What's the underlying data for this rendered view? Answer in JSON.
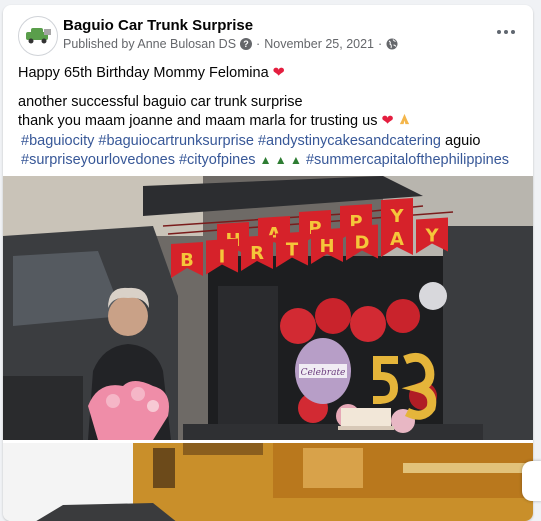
{
  "post": {
    "page_name": "Baguio Car Trunk Surprise",
    "published_by": "Published by Anne Bulosan DS",
    "date": "November 25, 2021",
    "separator": "·",
    "info_symbol": "?",
    "line1": "Happy 65th Birthday Mommy Felomina",
    "line2": "another successful baguio car trunk surprise",
    "line3": "thank you maam joanne and maam marla for trusting us",
    "hashtags": {
      "h1": "#baguiocity",
      "h2": "#baguiocartrunksurprise",
      "h3": "#andystinycakesandcatering",
      "plain1": "aguio",
      "h4": "#surpriseyourlovedones",
      "h5": "#cityofpines",
      "h6": "#summercapitalofthephilippines"
    }
  },
  "photo": {
    "banner_letters_top": [
      "H",
      "A",
      "P",
      "P",
      "Y"
    ],
    "banner_letters_bottom": [
      "B",
      "I",
      "R",
      "T",
      "H",
      "D",
      "A",
      "Y"
    ],
    "balloon_text": "Celebrate"
  },
  "icons": {
    "heart": "heart-icon",
    "folded_hands": "folded-hands-icon",
    "tree": "tree-icon",
    "globe": "globe-icon",
    "more": "more-options-icon"
  },
  "colors": {
    "link": "#385898",
    "banner": "#d6222a",
    "banner_letter": "#f5c63a",
    "balloon_red": "#d22a33",
    "gold": "#e5b53a"
  }
}
